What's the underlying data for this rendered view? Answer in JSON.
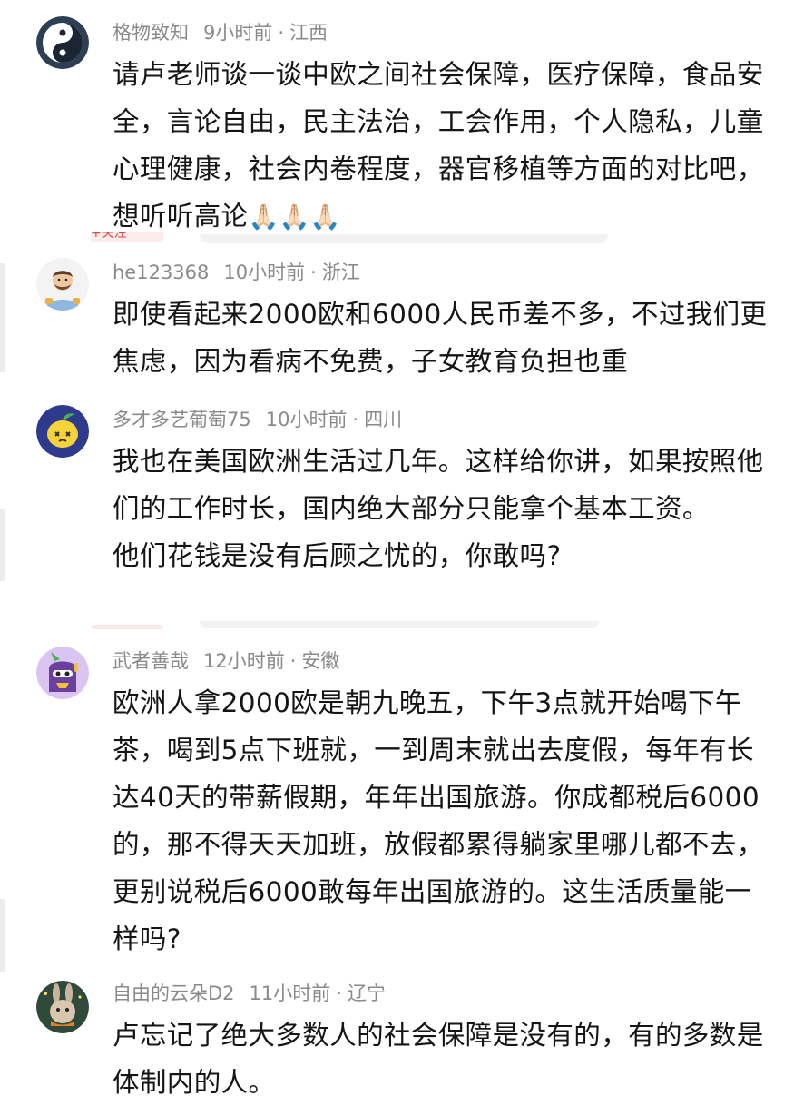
{
  "comments": [
    {
      "username": "格物致知",
      "time": "9小时前",
      "region": "江西",
      "avatar_icon": "yin-yang-icon",
      "text": "请卢老师谈一谈中欧之间社会保障，医疗保障，食品安全，言论自由，民主法治，工会作用，个人隐私，儿童心理健康，社会内卷程度，器官移植等方面的对比吧，想听听高论",
      "emoji": "🙏🏻🙏🏻🙏🏻"
    },
    {
      "username": "he123368",
      "time": "10小时前",
      "region": "浙江",
      "avatar_icon": "cartoon-man-avatar-icon",
      "text": "即使看起来2000欧和6000人民币差不多，不过我们更焦虑，因为看病不免费，子女教育负担也重"
    },
    {
      "username": "多才多艺葡萄75",
      "time": "10小时前",
      "region": "四川",
      "avatar_icon": "lemon-avatar-icon",
      "text": "我也在美国欧洲生活过几年。这样给你讲，如果按照他们的工作时长，国内绝大部分只能拿个基本工资。\n他们花钱是没有后顾之忧的，你敢吗?"
    },
    {
      "username": "武者善哉",
      "time": "12小时前",
      "region": "安徽",
      "avatar_icon": "purple-monster-avatar-icon",
      "text": "欧洲人拿2000欧是朝九晚五，下午3点就开始喝下午茶，喝到5点下班就，一到周末就出去度假，每年有长达40天的带薪假期，年年出国旅游。你成都税后6000的，那不得天天加班，放假都累得躺家里哪儿都不去，更别说税后6000敢每年出国旅游的。这生活质量能一样吗?"
    },
    {
      "username": "自由的云朵D2",
      "time": "11小时前",
      "region": "辽宁",
      "avatar_icon": "rabbit-avatar-icon",
      "text": "卢忘记了绝大多数人的社会保障是没有的，有的多数是体制内的人。"
    }
  ],
  "separator": "·",
  "partial_labels": {
    "follow_tag": "+关注"
  },
  "colors": {
    "meta_text": "#8a8a8a",
    "body_text": "#151515",
    "accent_red": "#e0454a"
  }
}
